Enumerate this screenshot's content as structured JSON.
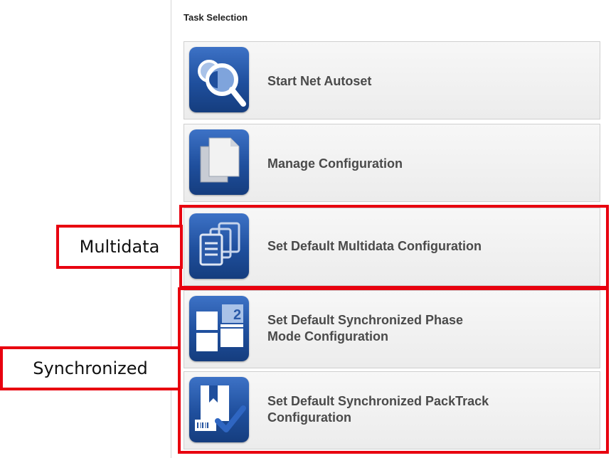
{
  "panel": {
    "title": "Task Selection"
  },
  "tasks": [
    {
      "label": "Start Net Autoset",
      "icon": "autoset-magnifier-icon"
    },
    {
      "label": "Manage Configuration",
      "icon": "document-icon"
    },
    {
      "label": "Set Default Multidata Configuration",
      "icon": "multidata-documents-icon"
    },
    {
      "label_line1": "Set Default Synchronized Phase",
      "label_line2": "Mode Configuration",
      "icon": "synchronized-phase-icon"
    },
    {
      "label_line1": "Set Default Synchronized PackTrack",
      "label_line2": "Configuration",
      "icon": "packtrack-check-icon"
    }
  ],
  "annotations": {
    "multidata": "Multidata",
    "synchronized": "Synchronized"
  },
  "colors": {
    "icon_blue": "#1f4f9d",
    "highlight_red": "#e8000f",
    "label_gray": "#4a4a4a"
  }
}
